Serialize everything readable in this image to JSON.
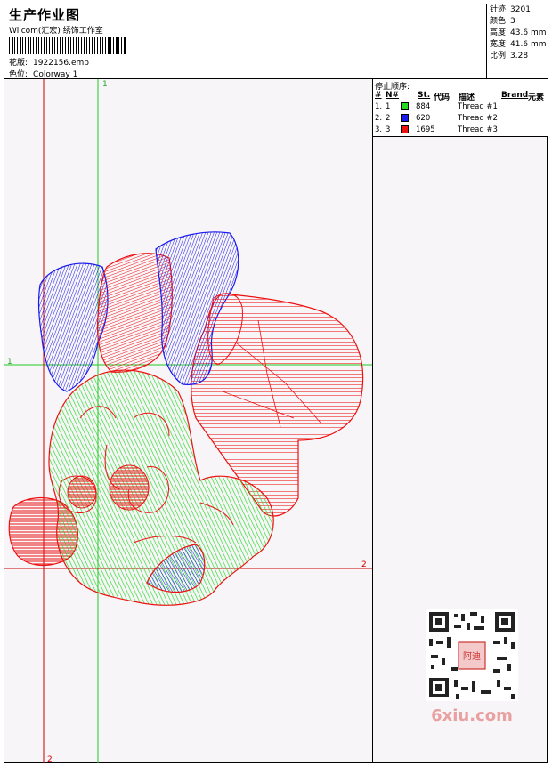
{
  "header": {
    "title": "生产作业图",
    "company": "Wilcom(汇宏) 绣饰工作室",
    "design_label": "花版:",
    "design_value": "1922156.emb",
    "colorway_label": "色位:",
    "colorway_value": "Colorway 1"
  },
  "stats": [
    {
      "label": "针迹:",
      "value": "3201"
    },
    {
      "label": "颜色:",
      "value": "3"
    },
    {
      "label": "高度:",
      "value": "43.6 mm"
    },
    {
      "label": "宽度:",
      "value": "41.6 mm"
    },
    {
      "label": "比例:",
      "value": "3.28"
    }
  ],
  "stop_sequence": {
    "title": "停止顺序:",
    "columns": [
      "#",
      "N#",
      "St.",
      "代码",
      "描述",
      "Brand",
      "元素"
    ],
    "rows": [
      {
        "index": "1.",
        "needle": "1",
        "color": "#22dd22",
        "code": "884",
        "description": "Thread #1"
      },
      {
        "index": "2.",
        "needle": "2",
        "color": "#1a1aee",
        "code": "620",
        "description": "Thread #2"
      },
      {
        "index": "3.",
        "needle": "3",
        "color": "#ee1111",
        "code": "1695",
        "description": "Thread #3"
      }
    ]
  },
  "guides": {
    "v1_label": "1",
    "h1_label": "1",
    "h2_label": "2",
    "v2_label": "2"
  },
  "watermark": {
    "qr_caption": "6xiu.com",
    "stamp_text": "阿迪"
  },
  "colors": {
    "green": "#22dd22",
    "blue": "#1a1aee",
    "red": "#ee1111",
    "guide_green": "#22cc22",
    "guide_red": "#cc0000"
  }
}
